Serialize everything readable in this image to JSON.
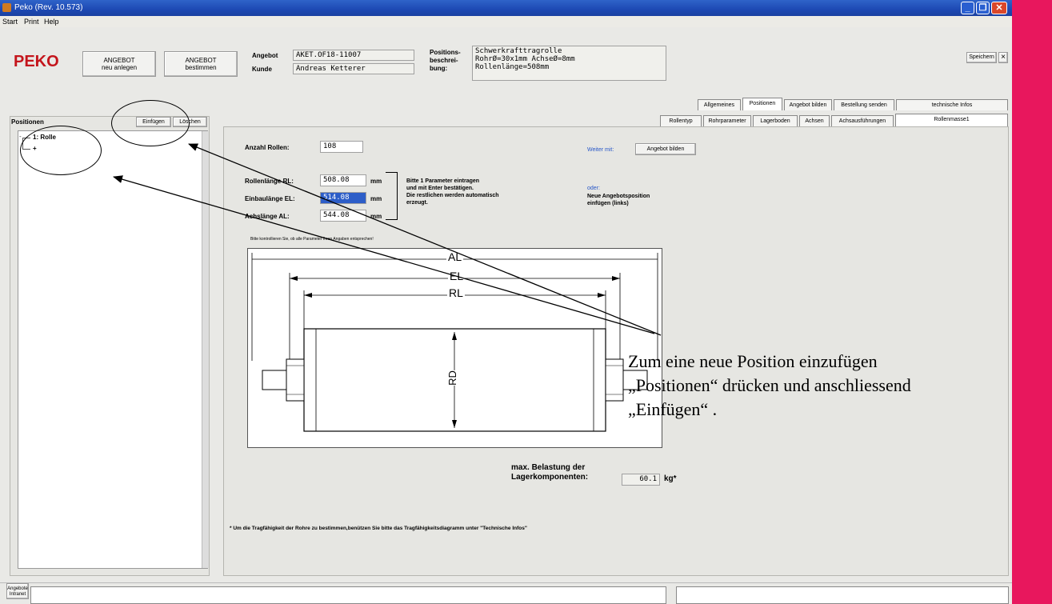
{
  "window": {
    "title": "Peko  (Rev. 10.573)",
    "min": "_",
    "max": "❐",
    "close": "✕"
  },
  "menu": [
    "Start",
    "Print",
    "Help"
  ],
  "logo": "PEKO",
  "toolbar": {
    "new_offer": [
      "ANGEBOT",
      "neu anlegen"
    ],
    "define_offer": [
      "ANGEBOT",
      "bestimmen"
    ],
    "save": "Speichern",
    "close": "×"
  },
  "offer": {
    "angebot_label": "Angebot",
    "angebot_value": "AKET.OF18-11007",
    "kunde_label": "Kunde",
    "kunde_value": "Andreas Ketterer"
  },
  "position_desc": {
    "label": [
      "Positions-",
      "beschrei-",
      "bung:"
    ],
    "lines": [
      "Schwerkrafttragrolle",
      "RohrØ=30x1mm AchseØ=8mm",
      "Rollenlänge=508mm"
    ]
  },
  "main_tabs": [
    "Allgemeines",
    "Positionen",
    "Angebot bilden",
    "Bestellung senden",
    "technische Infos"
  ],
  "sub_tabs": [
    "Rollentyp",
    "Rohrparameter",
    "Lagerboden",
    "Achsen",
    "Achsausführungen",
    "Rollenmasse1"
  ],
  "positions_panel": {
    "title": "Positionen",
    "insert": "Einfügen",
    "delete": "Löschen",
    "tree": [
      "1: Rolle",
      "+"
    ],
    "collapse": "-"
  },
  "form": {
    "count_label": "Anzahl Rollen:",
    "count_value": "108",
    "rl_label": "Rollenlänge RL:",
    "rl_value": "508.08",
    "el_label": "Einbaulänge EL:",
    "el_value": "514.08",
    "al_label": "Achslänge AL:",
    "al_value": "544.08",
    "unit": "mm",
    "hint": [
      "Bitte 1 Parameter eintragen",
      "und mit Enter bestätigen.",
      "Die restlichen werden automatisch",
      "erzeugt."
    ],
    "check_note": "Bitte kontrollieren Sie, ob alle Parameter Ihren Angaben entsprechen!"
  },
  "side": {
    "next_label": "Weiter mit:",
    "next_button": "Angebot bilden",
    "or": "oder:",
    "new_pos": [
      "Neue Angebotsposition",
      "einfügen (links)"
    ]
  },
  "drawing": {
    "al": "AL",
    "el": "EL",
    "rl": "RL",
    "rd": "RD"
  },
  "load": {
    "label": [
      "max. Belastung der",
      "Lagerkomponenten:"
    ],
    "value": "60.1",
    "unit": "kg*"
  },
  "footnote": "* Um die Tragfähigkeit der Rohre zu bestimmen,benützen Sie bitte das Tragfähigkeitsdiagramm unter \"Technische Infos\"",
  "bottom_tab": [
    "Angebote",
    "Intranet"
  ],
  "callout": [
    "Zum eine neue Position einzufügen",
    "„Positionen“ drücken und anschliessend",
    "„Einfügen“ ."
  ],
  "colors": {
    "brand": "#c4151c",
    "title_bar": "#1d49b3",
    "side_bar": "#e8175d",
    "link_blue": "#2857c8"
  }
}
